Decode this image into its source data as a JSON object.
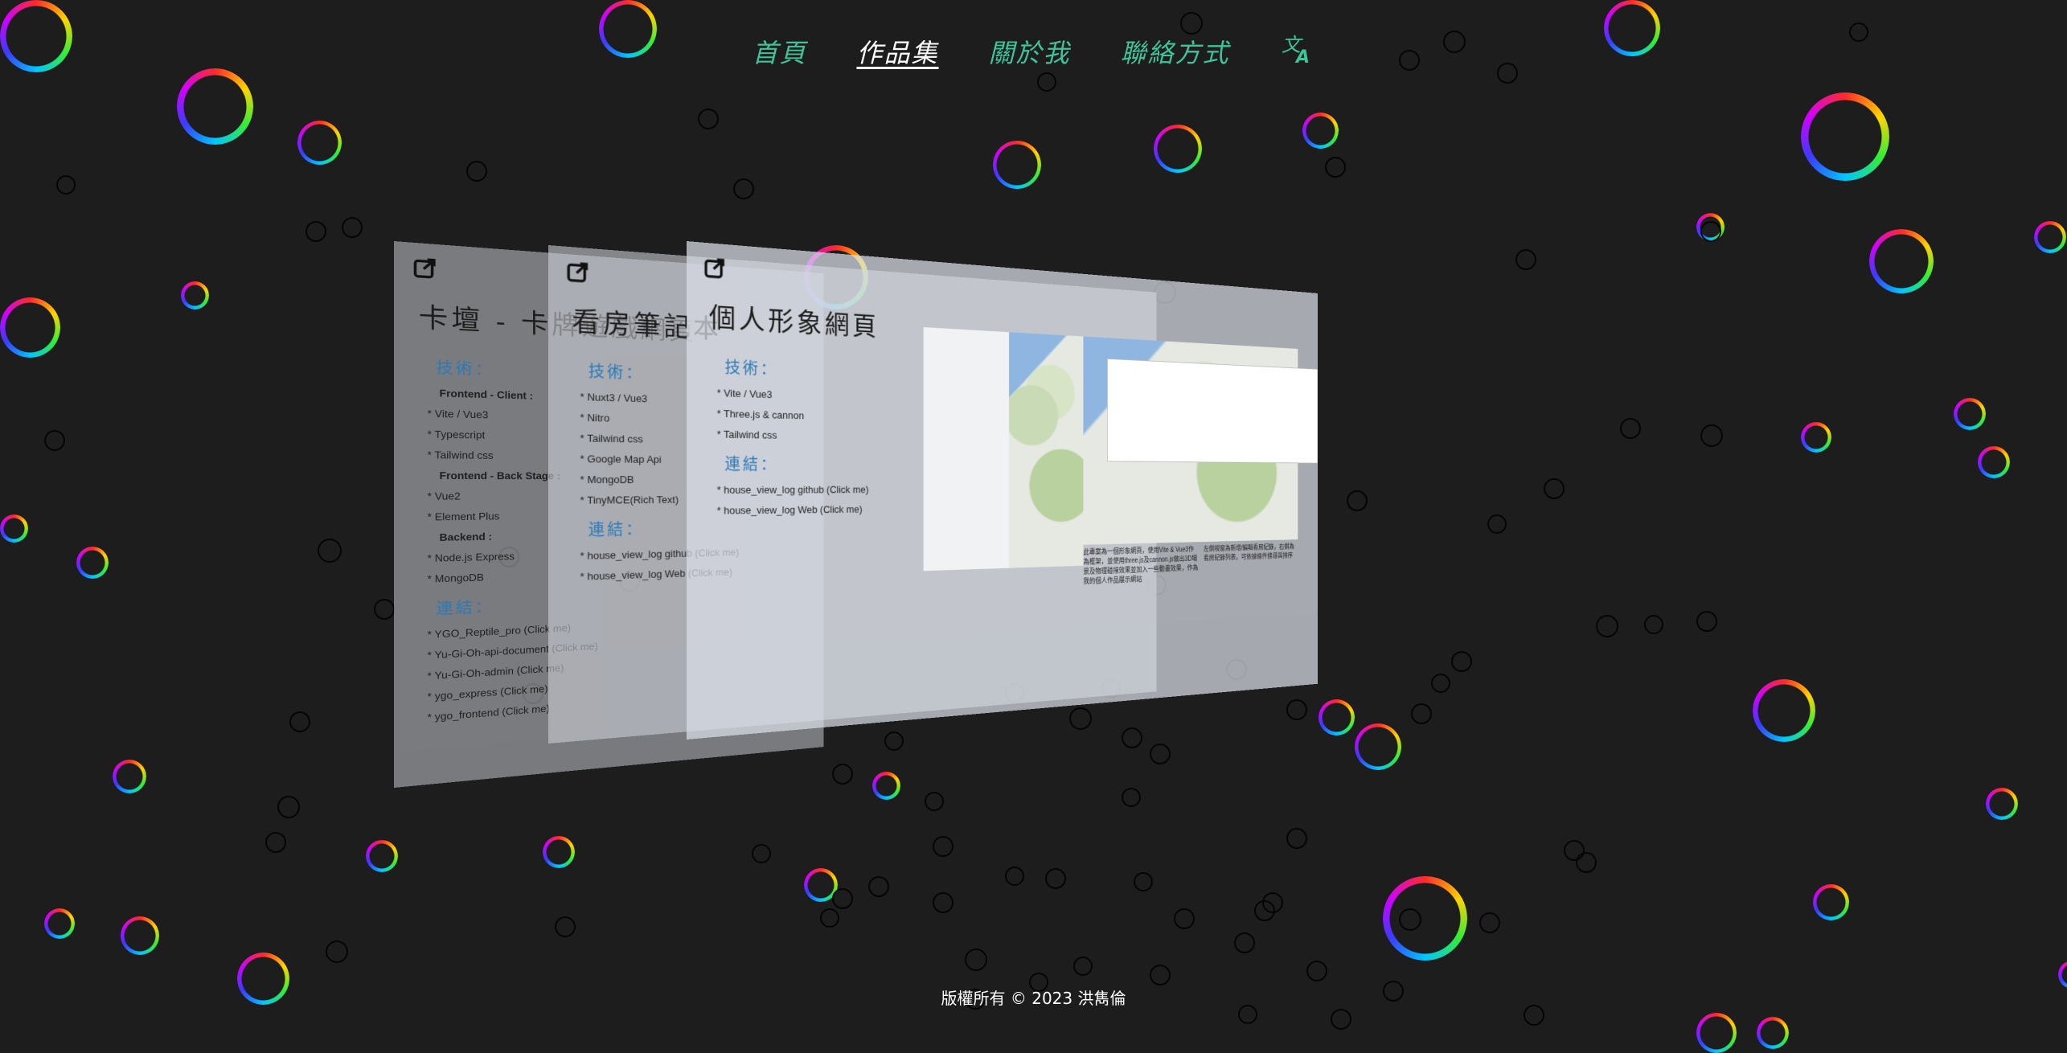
{
  "nav": {
    "home": "首頁",
    "portfolio": "作品集",
    "about": "關於我",
    "contact": "聯絡方式",
    "language_icon": "translate-icon"
  },
  "projects": [
    {
      "title": "卡壇 - 卡牌遊戲網頁",
      "tech_heading": "技術：",
      "tech_items": [
        {
          "text": "Frontend - Client :",
          "sub": true
        },
        {
          "text": "* Vite / Vue3"
        },
        {
          "text": "* Typescript"
        },
        {
          "text": "* Tailwind css"
        },
        {
          "text": "Frontend - Back Stage :",
          "sub": true
        },
        {
          "text": "* Vue2"
        },
        {
          "text": "* Element Plus"
        },
        {
          "text": "Backend :",
          "sub": true
        },
        {
          "text": "* Node.js Express"
        },
        {
          "text": "* MongoDB"
        }
      ],
      "links_heading": "連結：",
      "links": [
        "* YGO_Reptile_pro (Click me)",
        "* Yu-Gi-Oh-api-document (Click me)",
        "* Yu-Gi-Oh-admin (Click me)",
        "* ygo_express (Click me)",
        "* ygo_frontend (Click me)"
      ]
    },
    {
      "title": "看房筆記本",
      "tech_heading": "技術：",
      "tech_items": [
        {
          "text": "* Nuxt3 / Vue3"
        },
        {
          "text": "* Nitro"
        },
        {
          "text": "* Tailwind css"
        },
        {
          "text": "* Google Map Api"
        },
        {
          "text": "* MongoDB"
        },
        {
          "text": "* TinyMCE(Rich Text)"
        }
      ],
      "links_heading": "連結：",
      "links": [
        "* house_view_log github (Click me)",
        "* house_view_log Web (Click me)"
      ]
    },
    {
      "title": "個人形象網頁",
      "tech_heading": "技術：",
      "tech_items": [
        {
          "text": "* Vite / Vue3"
        },
        {
          "text": "* Three.js & cannon"
        },
        {
          "text": "* Tailwind css"
        }
      ],
      "links_heading": "連結：",
      "links": [
        "* house_view_log github (Click me)",
        "* house_view_log Web (Click me)"
      ],
      "caption_left": "此專案為一個形象網頁，使用Vite & Vue3作為框架，並使用three.js及cannon.js做出3D場景及物理碰撞效果並加入一些動畫效果，作為我的個人作品展示網站",
      "caption_right": "左側視窗為新增/編輯看房紀錄，右側為看房紀錄列表，可依據條件搜尋與排序"
    }
  ],
  "footer": "版權所有 © 2023 洪雋倫"
}
